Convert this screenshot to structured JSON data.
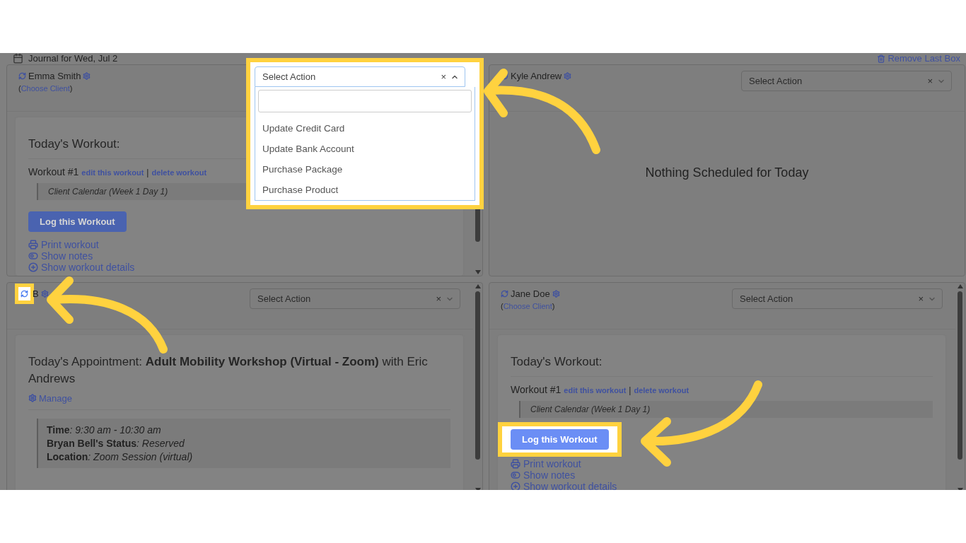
{
  "header": {
    "title": "Journal for Wed, Jul 2",
    "remove_label": "Remove Last Box"
  },
  "panels": [
    {
      "kind": "workout",
      "client": "Emma Smith",
      "choose_client": {
        "before": "(",
        "link": "Choose Client",
        "after": ")"
      },
      "icon_highlighted": false,
      "scrollbar": true,
      "select": {
        "placeholder": "Select Action",
        "clear": "×",
        "open": true,
        "highlighted": true,
        "options": [
          "Update Credit Card",
          "Update Bank Account",
          "Purchase Package",
          "Purchase Product"
        ]
      },
      "heading": "Today's Workout:",
      "workout_title": "Workout #1",
      "edit_link": "edit this workout",
      "separator": "|",
      "delete_link": "delete workout",
      "calendar": "Client Calendar (Week 1 Day 1)",
      "log_button": "Log this Workout",
      "log_highlighted": false,
      "links": [
        {
          "kind": "print",
          "label": "Print workout"
        },
        {
          "kind": "notes",
          "label": "Show notes"
        },
        {
          "kind": "details",
          "label": "Show workout details"
        }
      ]
    },
    {
      "kind": "empty",
      "client": "Kyle Andrew",
      "icon_highlighted": false,
      "scrollbar": false,
      "select": {
        "placeholder": "Select Action",
        "clear": "×",
        "open": false,
        "highlighted": false
      },
      "message": "Nothing Scheduled for Today"
    },
    {
      "kind": "appointment",
      "client": "B",
      "icon_highlighted": true,
      "scrollbar": true,
      "select": {
        "placeholder": "Select Action",
        "clear": "×",
        "open": false,
        "highlighted": false
      },
      "heading": "Today's Appointment: **Adult Mobility Workshop (Virtual - Zoom)** with Eric Andrews",
      "manage": "Manage",
      "details": [
        {
          "label": "Time",
          "value": ": 9:30 am - 10:30 am"
        },
        {
          "label": "Bryan Bell's Status",
          "value": ": Reserved"
        },
        {
          "label": "Location",
          "value": ": Zoom Session (virtual)"
        }
      ]
    },
    {
      "kind": "workout",
      "client": "Jane Doe",
      "choose_client": {
        "before": "(",
        "link": "Choose Client",
        "after": ")"
      },
      "icon_highlighted": false,
      "scrollbar": true,
      "select": {
        "placeholder": "Select Action",
        "clear": "×",
        "open": false,
        "highlighted": false
      },
      "heading": "Today's Workout:",
      "workout_title": "Workout #1",
      "edit_link": "edit this workout",
      "separator": "|",
      "delete_link": "delete workout",
      "calendar": "Client Calendar (Week 1 Day 1)",
      "log_button": "Log this Workout",
      "log_highlighted": true,
      "links": [
        {
          "kind": "print",
          "label": "Print workout"
        },
        {
          "kind": "notes",
          "label": "Show notes"
        },
        {
          "kind": "details",
          "label": "Show workout details"
        }
      ]
    }
  ]
}
